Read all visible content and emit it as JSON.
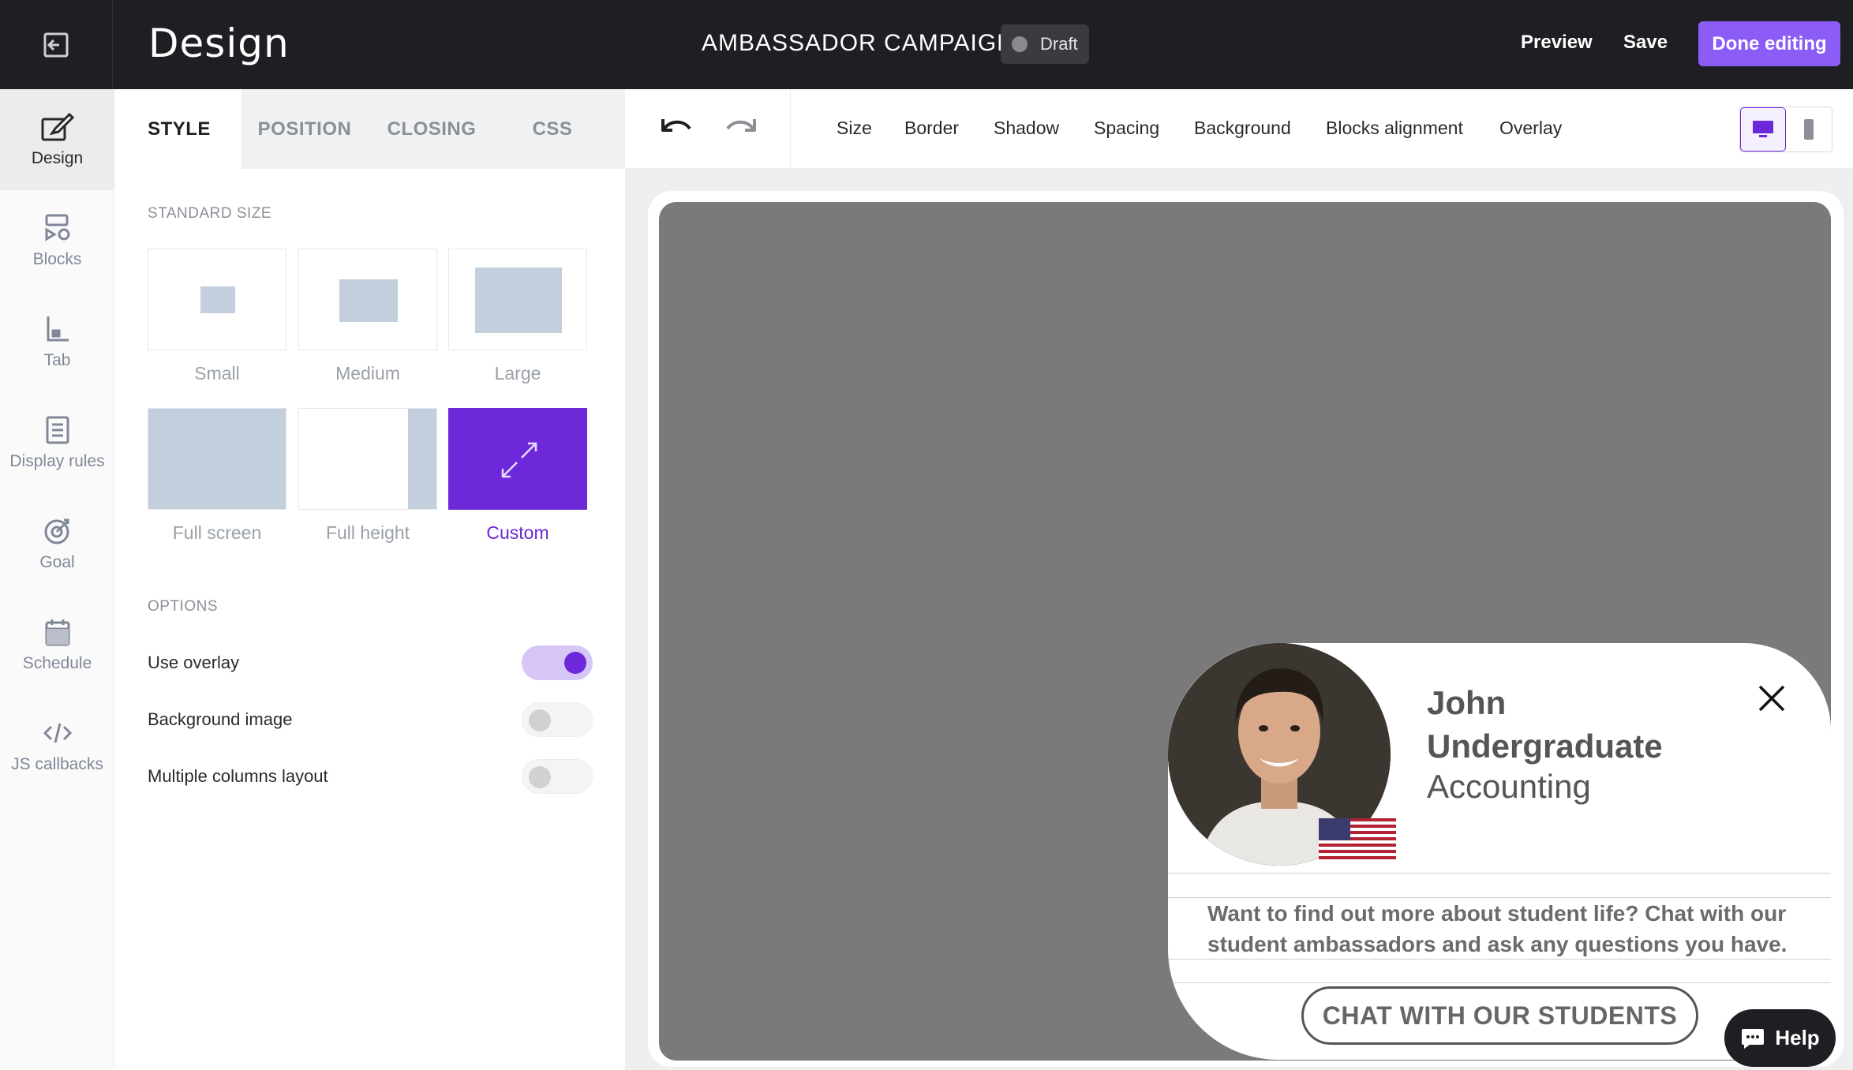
{
  "header": {
    "app_title": "Design",
    "campaign_name": "AMBASSADOR CAMPAIGN",
    "status_badge": "Draft",
    "preview_label": "Preview",
    "save_label": "Save",
    "done_label": "Done editing"
  },
  "rail": {
    "items": [
      {
        "label": "Design",
        "icon": "design-icon",
        "active": true
      },
      {
        "label": "Blocks",
        "icon": "blocks-icon"
      },
      {
        "label": "Tab",
        "icon": "tab-icon"
      },
      {
        "label": "Display rules",
        "icon": "display-rules-icon"
      },
      {
        "label": "Goal",
        "icon": "goal-icon"
      },
      {
        "label": "Schedule",
        "icon": "calendar-icon"
      },
      {
        "label": "JS callbacks",
        "icon": "code-icon"
      }
    ]
  },
  "panel": {
    "tabs": [
      {
        "label": "STYLE",
        "active": true
      },
      {
        "label": "POSITION"
      },
      {
        "label": "CLOSING"
      },
      {
        "label": "CSS"
      }
    ],
    "standard_size_label": "STANDARD SIZE",
    "sizes": [
      {
        "label": "Small"
      },
      {
        "label": "Medium"
      },
      {
        "label": "Large"
      },
      {
        "label": "Full screen"
      },
      {
        "label": "Full height"
      },
      {
        "label": "Custom",
        "selected": true
      }
    ],
    "options_label": "OPTIONS",
    "options": [
      {
        "label": "Use overlay",
        "enabled": true
      },
      {
        "label": "Background image",
        "enabled": false
      },
      {
        "label": "Multiple columns layout",
        "enabled": false
      }
    ]
  },
  "toolbar": {
    "items": [
      "Size",
      "Border",
      "Shadow",
      "Spacing",
      "Background",
      "Blocks alignment",
      "Overlay"
    ],
    "device_selected": "desktop"
  },
  "popup": {
    "name": "John Undergraduate",
    "major": "Accounting",
    "text": "Want to find out more about student life? Chat with our student ambassadors and ask any questions you have.",
    "cta": "CHAT WITH OUR STUDENTS"
  },
  "help": {
    "label": "Help"
  },
  "colors": {
    "accent": "#6d28d9",
    "done_button": "#8b5cf6",
    "topbar": "#1e1e23",
    "overlay": "#7a7a7a"
  }
}
